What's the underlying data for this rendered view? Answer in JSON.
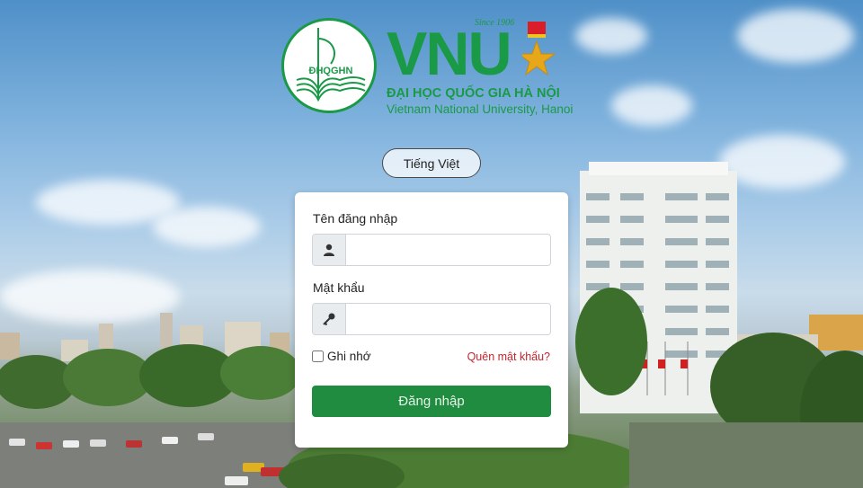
{
  "brand": {
    "seal_text": "ĐHQGHN",
    "acronym": "VNU",
    "since": "Since 1906",
    "name_vi": "ĐẠI HỌC QUỐC GIA HÀ NỘI",
    "name_en": "Vietnam National University, Hanoi",
    "color": "#1a9a46"
  },
  "language_button": {
    "label": "Tiếng Việt"
  },
  "login_form": {
    "username_label": "Tên đăng nhập",
    "username_value": "",
    "username_icon": "user-icon",
    "password_label": "Mật khẩu",
    "password_value": "",
    "password_icon": "key-icon",
    "remember_label": "Ghi nhớ",
    "remember_checked": false,
    "forgot_link": "Quên mật khẩu?",
    "submit_label": "Đăng nhập",
    "submit_color": "#1f8c3f",
    "forgot_color": "#c0262d"
  }
}
